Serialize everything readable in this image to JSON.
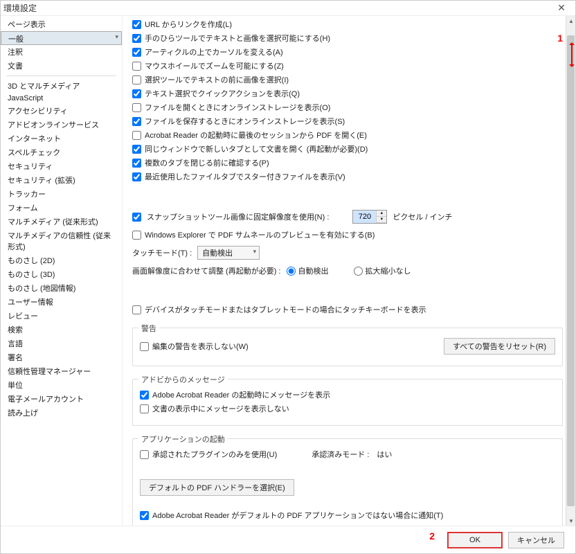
{
  "title": "環境設定",
  "sidebar": [
    "ページ表示",
    "一般",
    "注釈",
    "文書",
    "",
    "3D とマルチメディア",
    "JavaScript",
    "アクセシビリティ",
    "アドビオンラインサービス",
    "インターネット",
    "スペルチェック",
    "セキュリティ",
    "セキュリティ (拡張)",
    "トラッカー",
    "フォーム",
    "マルチメディア (従来形式)",
    "マルチメディアの信頼性 (従来形式)",
    "ものさし (2D)",
    "ものさし (3D)",
    "ものさし (地図情報)",
    "ユーザー情報",
    "レビュー",
    "検索",
    "言語",
    "署名",
    "信頼性管理マネージャー",
    "単位",
    "電子メールアカウント",
    "読み上げ"
  ],
  "sidebar_selected": "一般",
  "checks": [
    {
      "c": true,
      "t": "URL からリンクを作成(L)"
    },
    {
      "c": true,
      "t": "手のひらツールでテキストと画像を選択可能にする(H)"
    },
    {
      "c": true,
      "t": "アーティクルの上でカーソルを変える(A)"
    },
    {
      "c": false,
      "t": "マウスホイールでズームを可能にする(Z)"
    },
    {
      "c": false,
      "t": "選択ツールでテキストの前に画像を選択(I)"
    },
    {
      "c": true,
      "t": "テキスト選択でクイックアクションを表示(Q)"
    },
    {
      "c": false,
      "t": "ファイルを開くときにオンラインストレージを表示(O)"
    },
    {
      "c": true,
      "t": "ファイルを保存するときにオンラインストレージを表示(S)"
    },
    {
      "c": false,
      "t": "Acrobat Reader の起動時に最後のセッションから PDF を開く(E)"
    },
    {
      "c": true,
      "t": "同じウィンドウで新しいタブとして文書を開く (再起動が必要)(D)"
    },
    {
      "c": true,
      "t": "複数のタブを閉じる前に確認する(P)"
    },
    {
      "c": true,
      "t": "最近使用したファイルタブでスター付きファイルを表示(V)"
    }
  ],
  "snap": {
    "c": true,
    "t": "スナップショットツール画像に固定解像度を使用(N) :",
    "val": "720",
    "unit": "ピクセル / インチ"
  },
  "explorer": {
    "c": false,
    "t": "Windows Explorer で PDF サムネールのプレビューを有効にする(B)"
  },
  "touch": {
    "lbl": "タッチモード(T) :",
    "val": "自動検出"
  },
  "reso": {
    "lbl": "画面解像度に合わせて調整 (再起動が必要) :",
    "r1": "自動検出",
    "r2": "拡大縮小なし"
  },
  "tabletkb": {
    "c": false,
    "t": "デバイスがタッチモードまたはタブレットモードの場合にタッチキーボードを表示"
  },
  "warn": {
    "legend": "警告",
    "chk": {
      "c": false,
      "t": "編集の警告を表示しない(W)"
    },
    "reset": "すべての警告をリセット(R)"
  },
  "adobe": {
    "legend": "アドビからのメッセージ",
    "c1": {
      "c": true,
      "t": "Adobe Acrobat Reader の起動時にメッセージを表示"
    },
    "c2": {
      "c": false,
      "t": "文書の表示中にメッセージを表示しない"
    }
  },
  "app": {
    "legend": "アプリケーションの起動",
    "chk": {
      "c": false,
      "t": "承認されたプラグインのみを使用(U)"
    },
    "mode": "承認済みモード :　はい",
    "handler": "デフォルトの PDF ハンドラーを選択(E)",
    "def": {
      "c": true,
      "t": "Adobe Acrobat Reader がデフォルトの PDF アプリケーションではない場合に通知(T)"
    }
  },
  "ok": "OK",
  "cancel": "キャンセル",
  "ann1": "1",
  "ann2": "2"
}
